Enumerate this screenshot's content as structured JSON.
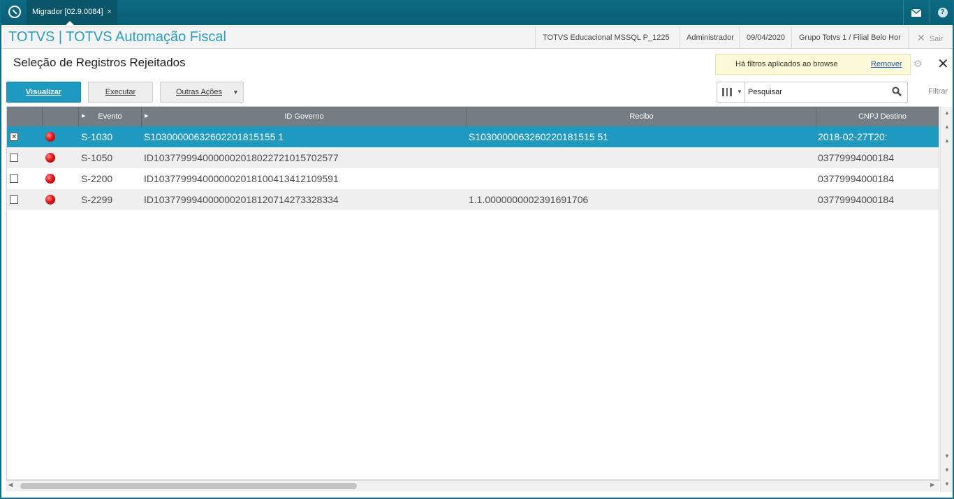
{
  "topbar": {
    "tab_label": "Migrador [02.9.0084]",
    "tab_close": "×"
  },
  "header": {
    "app_title": "TOTVS | TOTVS Automação Fiscal",
    "environment": "TOTVS Educacional MSSQL P_1225",
    "user": "Administrador",
    "date": "09/04/2020",
    "branch": "Grupo Totvs 1 / Filial Belo Hor",
    "exit_label": "Sair"
  },
  "page": {
    "title": "Seleção de Registros Rejeitados",
    "filter_notice": "Há filtros aplicados ao browse",
    "remove_label": "Remover"
  },
  "toolbar": {
    "view_label": "Visualizar",
    "execute_label": "Executar",
    "more_label": "Outras Ações"
  },
  "search": {
    "value": "Pesquisar",
    "filter_label": "Filtrar"
  },
  "grid": {
    "columns": [
      "Evento",
      "ID Governo",
      "Recibo",
      "CNPJ Destino"
    ],
    "rows": [
      {
        "checked": true,
        "status": "red",
        "evento": "S-1030",
        "id_governo": "S10300000632602201815155 1",
        "recibo": "S1030000063260220181515 51",
        "cnpj": "2018-02-27T20:"
      },
      {
        "checked": false,
        "status": "red",
        "evento": "S-1050",
        "id_governo": "ID1037799940000002018022721015702577",
        "recibo": "",
        "cnpj": "03779994000184"
      },
      {
        "checked": false,
        "status": "red",
        "evento": "S-2200",
        "id_governo": "ID1037799940000002018100413412109591",
        "recibo": "",
        "cnpj": "03779994000184"
      },
      {
        "checked": false,
        "status": "red",
        "evento": "S-2299",
        "id_governo": "ID1037799940000002018120714273328334",
        "recibo": "1.1.0000000002391691706",
        "cnpj": "03779994000184"
      }
    ]
  },
  "colors": {
    "topbar": "#0d6a82",
    "accent": "#1e9ac0",
    "grid_header": "#737d83",
    "status_red": "#e01818"
  }
}
